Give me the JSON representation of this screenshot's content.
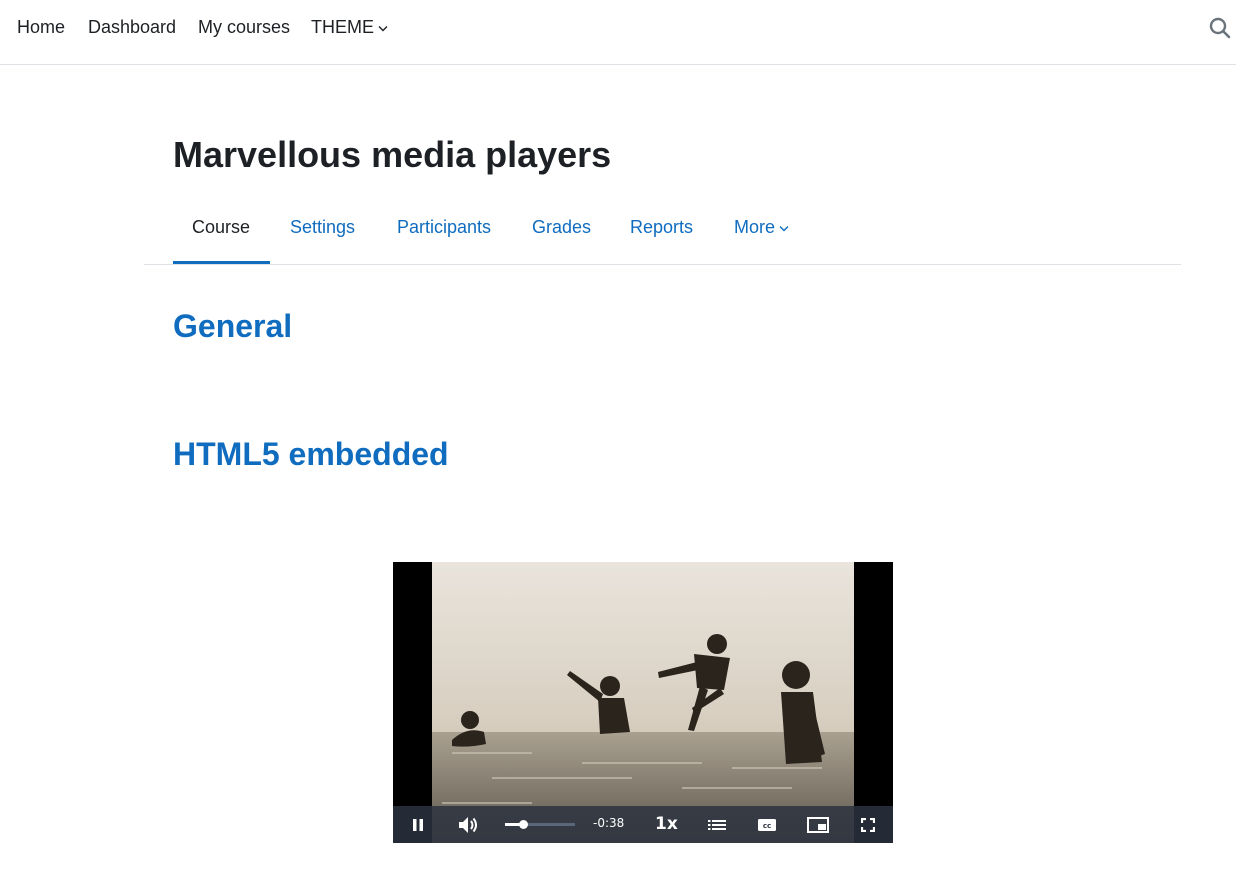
{
  "navbar": {
    "items": [
      {
        "label": "Home"
      },
      {
        "label": "Dashboard"
      },
      {
        "label": "My courses"
      },
      {
        "label": "THEME"
      }
    ],
    "search_icon": "search-icon"
  },
  "page": {
    "title": "Marvellous media players"
  },
  "secondary_nav": {
    "tabs": [
      {
        "label": "Course",
        "active": true
      },
      {
        "label": "Settings"
      },
      {
        "label": "Participants"
      },
      {
        "label": "Grades"
      },
      {
        "label": "Reports"
      },
      {
        "label": "More"
      }
    ]
  },
  "sections": [
    {
      "title": "General"
    },
    {
      "title": "HTML5 embedded"
    }
  ],
  "player": {
    "state": "playing",
    "time_remaining": "-0:38",
    "playback_rate": "1x",
    "volume_level": 0.25,
    "icons": [
      "pause-icon",
      "volume-icon",
      "chapters-icon",
      "captions-icon",
      "picture-in-picture-icon",
      "fullscreen-icon"
    ]
  },
  "colors": {
    "accent": "#0f6cbf",
    "text": "#1d2125",
    "border": "#dee2e6"
  }
}
